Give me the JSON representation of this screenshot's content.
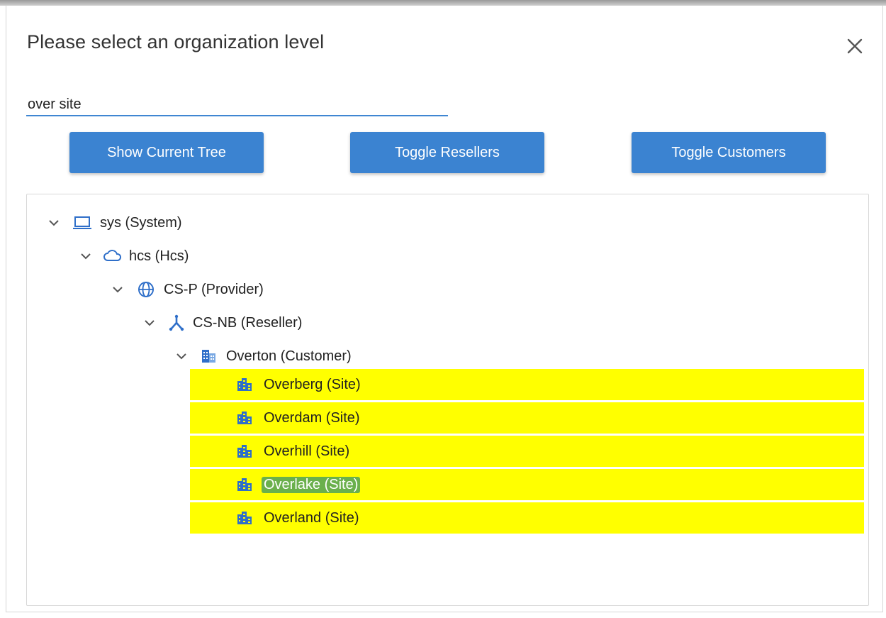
{
  "dialog": {
    "title": "Please select an organization level"
  },
  "search": {
    "value": "over site",
    "placeholder": ""
  },
  "buttons": {
    "show_current_tree": "Show Current Tree",
    "toggle_resellers": "Toggle Resellers",
    "toggle_customers": "Toggle Customers"
  },
  "colors": {
    "accent": "#3b83d1",
    "highlight": "#ffff00",
    "selection": "#6ab04c"
  },
  "tree": {
    "nodes": [
      {
        "label": "sys (System)",
        "icon": "laptop-icon",
        "expanded": true
      },
      {
        "label": "hcs (Hcs)",
        "icon": "cloud-icon",
        "expanded": true
      },
      {
        "label": "CS-P (Provider)",
        "icon": "globe-icon",
        "expanded": true
      },
      {
        "label": "CS-NB (Reseller)",
        "icon": "network-icon",
        "expanded": true
      },
      {
        "label": "Overton (Customer)",
        "icon": "building-icon",
        "expanded": true
      },
      {
        "label": "Overberg (Site)",
        "icon": "site-icon",
        "highlighted": true
      },
      {
        "label": "Overdam (Site)",
        "icon": "site-icon",
        "highlighted": true
      },
      {
        "label": "Overhill (Site)",
        "icon": "site-icon",
        "highlighted": true
      },
      {
        "label": "Overlake (Site)",
        "icon": "site-icon",
        "highlighted": true,
        "selected": true
      },
      {
        "label": "Overland (Site)",
        "icon": "site-icon",
        "highlighted": true
      }
    ]
  }
}
